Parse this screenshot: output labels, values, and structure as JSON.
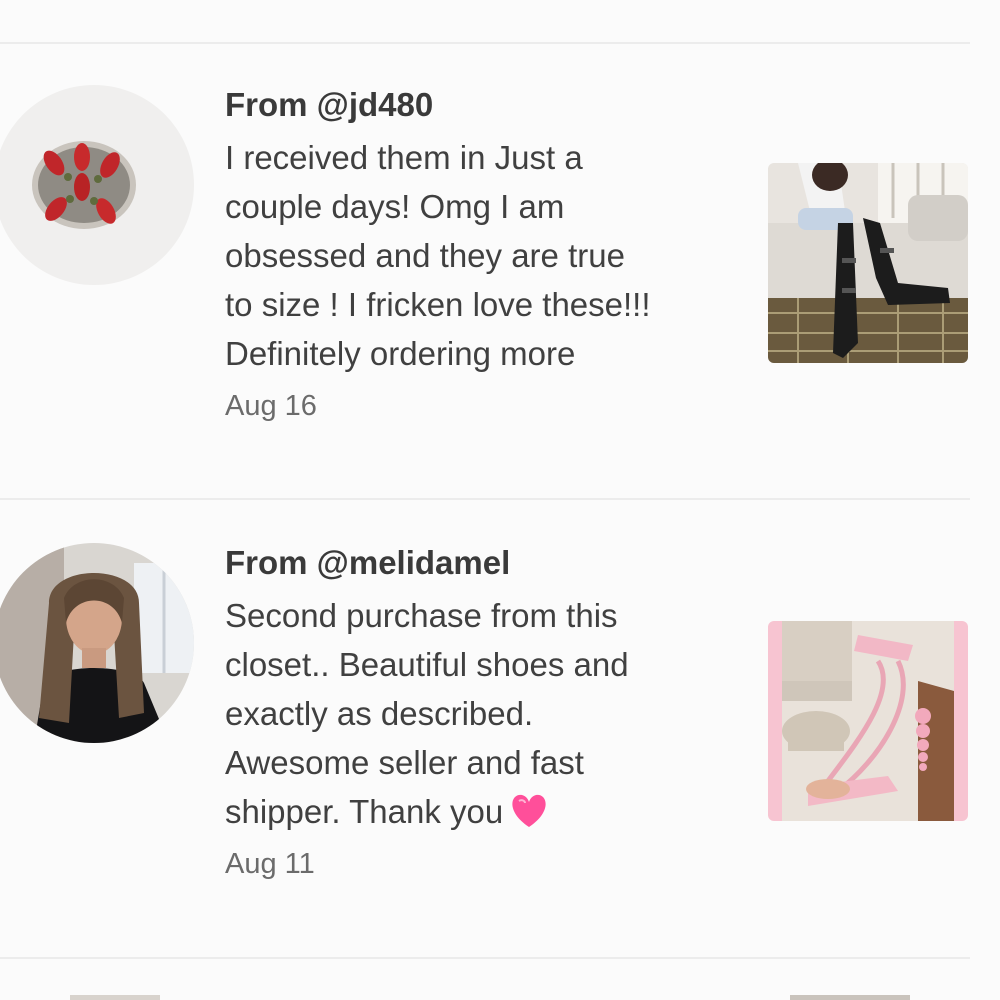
{
  "reviews": [
    {
      "from": "From @jd480",
      "text": "I received them in Just a\ncouple days! Omg I am\nobsessed and they are true\nto size ! I fricken love these!!!\nDefinitely ordering more",
      "date": "Aug 16",
      "avatar_icon": "coral-ring-avatar",
      "photo_icon": "black-boots-photo"
    },
    {
      "from": "From @melidamel",
      "text": "Second purchase from this\ncloset.. Beautiful shoes and\nexactly as described.\nAwesome seller and fast\nshipper. Thank you",
      "date": "Aug 11",
      "avatar_icon": "woman-portrait-avatar",
      "photo_icon": "pink-sandals-photo",
      "emoji": "pink-heart-icon"
    }
  ],
  "colors": {
    "background": "#fbfbfb",
    "divider": "#ececec",
    "name": "#3a3a3a",
    "body": "#404040",
    "date": "#6b6b6b",
    "heart": "#ff4f9a"
  }
}
